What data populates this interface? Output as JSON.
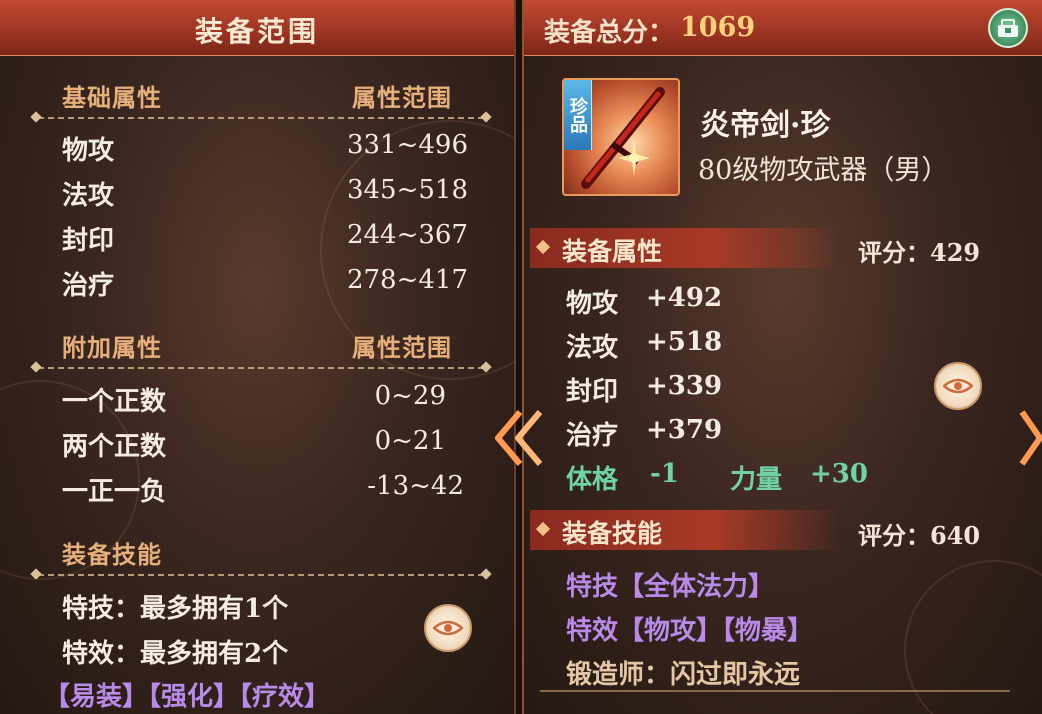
{
  "left": {
    "title": "装备范围",
    "base": {
      "header": "基础属性",
      "range_header": "属性范围",
      "rows": [
        {
          "label": "物攻",
          "range": "331~496"
        },
        {
          "label": "法攻",
          "range": "345~518"
        },
        {
          "label": "封印",
          "range": "244~367"
        },
        {
          "label": "治疗",
          "range": "278~417"
        }
      ]
    },
    "extra": {
      "header": "附加属性",
      "range_header": "属性范围",
      "rows": [
        {
          "label": "一个正数",
          "range": "0~29"
        },
        {
          "label": "两个正数",
          "range": "0~21"
        },
        {
          "label": "一正一负",
          "range": "-13~42"
        }
      ]
    },
    "skills": {
      "header": "装备技能",
      "stunt": "特技：最多拥有1个",
      "effect": "特效：最多拥有2个",
      "tags": "【易装】【强化】【疗效】"
    }
  },
  "right": {
    "total_label": "装备总分：",
    "total_value": "1069",
    "item": {
      "rarity": "珍品",
      "name": "炎帝剑·珍",
      "type": "80级物攻武器（男）"
    },
    "attrs": {
      "header": "装备属性",
      "score": "评分：429",
      "rows": [
        {
          "label": "物攻",
          "value": "+492"
        },
        {
          "label": "法攻",
          "value": "+518"
        },
        {
          "label": "封印",
          "value": "+339"
        },
        {
          "label": "治疗",
          "value": "+379"
        }
      ],
      "bonus": [
        {
          "label": "体格",
          "value": "-1"
        },
        {
          "label": "力量",
          "value": "+30"
        }
      ]
    },
    "skills": {
      "header": "装备技能",
      "score": "评分：640",
      "stunt": "特技【全体法力】",
      "effect": "特效【物攻】【物暴】",
      "smith": "锻造师：闪过即永远"
    }
  },
  "colors": {
    "header_red": "#9c3322",
    "section_gold": "#e6b07a",
    "skill_purple": "#b98ae8",
    "bonus_green": "#6fd4a4",
    "total_gold": "#ffd27a"
  },
  "icons": [
    "share-icon",
    "eye-icon",
    "chevron-left-icon",
    "chevron-right-icon",
    "sword-icon"
  ]
}
